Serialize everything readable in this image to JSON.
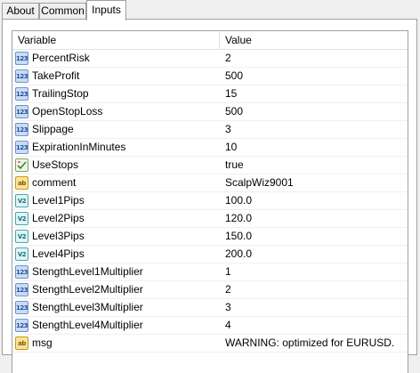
{
  "tabs": [
    {
      "label": "About",
      "active": false
    },
    {
      "label": "Common",
      "active": false
    },
    {
      "label": "Inputs",
      "active": true
    }
  ],
  "table": {
    "headers": {
      "variable": "Variable",
      "value": "Value"
    },
    "rows": [
      {
        "name": "PercentRisk",
        "value": "2",
        "type": "int",
        "icon": "integer-icon",
        "icon_text": "123"
      },
      {
        "name": "TakeProfit",
        "value": "500",
        "type": "int",
        "icon": "integer-icon",
        "icon_text": "123"
      },
      {
        "name": "TrailingStop",
        "value": "15",
        "type": "int",
        "icon": "integer-icon",
        "icon_text": "123"
      },
      {
        "name": "OpenStopLoss",
        "value": "500",
        "type": "int",
        "icon": "integer-icon",
        "icon_text": "123"
      },
      {
        "name": "Slippage",
        "value": "3",
        "type": "int",
        "icon": "integer-icon",
        "icon_text": "123"
      },
      {
        "name": "ExpirationInMinutes",
        "value": "10",
        "type": "int",
        "icon": "integer-icon",
        "icon_text": "123"
      },
      {
        "name": "UseStops",
        "value": "true",
        "type": "bool",
        "icon": "boolean-icon",
        "icon_text": ""
      },
      {
        "name": "comment",
        "value": "ScalpWiz9001",
        "type": "str",
        "icon": "string-icon",
        "icon_text": "ab"
      },
      {
        "name": "Level1Pips",
        "value": "100.0",
        "type": "dbl",
        "icon": "double-icon",
        "icon_text": "V2"
      },
      {
        "name": "Level2Pips",
        "value": "120.0",
        "type": "dbl",
        "icon": "double-icon",
        "icon_text": "V2"
      },
      {
        "name": "Level3Pips",
        "value": "150.0",
        "type": "dbl",
        "icon": "double-icon",
        "icon_text": "V2"
      },
      {
        "name": "Level4Pips",
        "value": "200.0",
        "type": "dbl",
        "icon": "double-icon",
        "icon_text": "V2"
      },
      {
        "name": "StengthLevel1Multiplier",
        "value": "1",
        "type": "int",
        "icon": "integer-icon",
        "icon_text": "123"
      },
      {
        "name": "StengthLevel2Multiplier",
        "value": "2",
        "type": "int",
        "icon": "integer-icon",
        "icon_text": "123"
      },
      {
        "name": "StengthLevel3Multiplier",
        "value": "3",
        "type": "int",
        "icon": "integer-icon",
        "icon_text": "123"
      },
      {
        "name": "StengthLevel4Multiplier",
        "value": "4",
        "type": "int",
        "icon": "integer-icon",
        "icon_text": "123"
      },
      {
        "name": "msg",
        "value": "WARNING: optimized for EURUSD.",
        "type": "str",
        "icon": "string-icon",
        "icon_text": "ab"
      }
    ]
  },
  "colors": {
    "border": "#a0a0a0",
    "panel_background": "#ffffff",
    "window_background": "#f0f0f0"
  }
}
